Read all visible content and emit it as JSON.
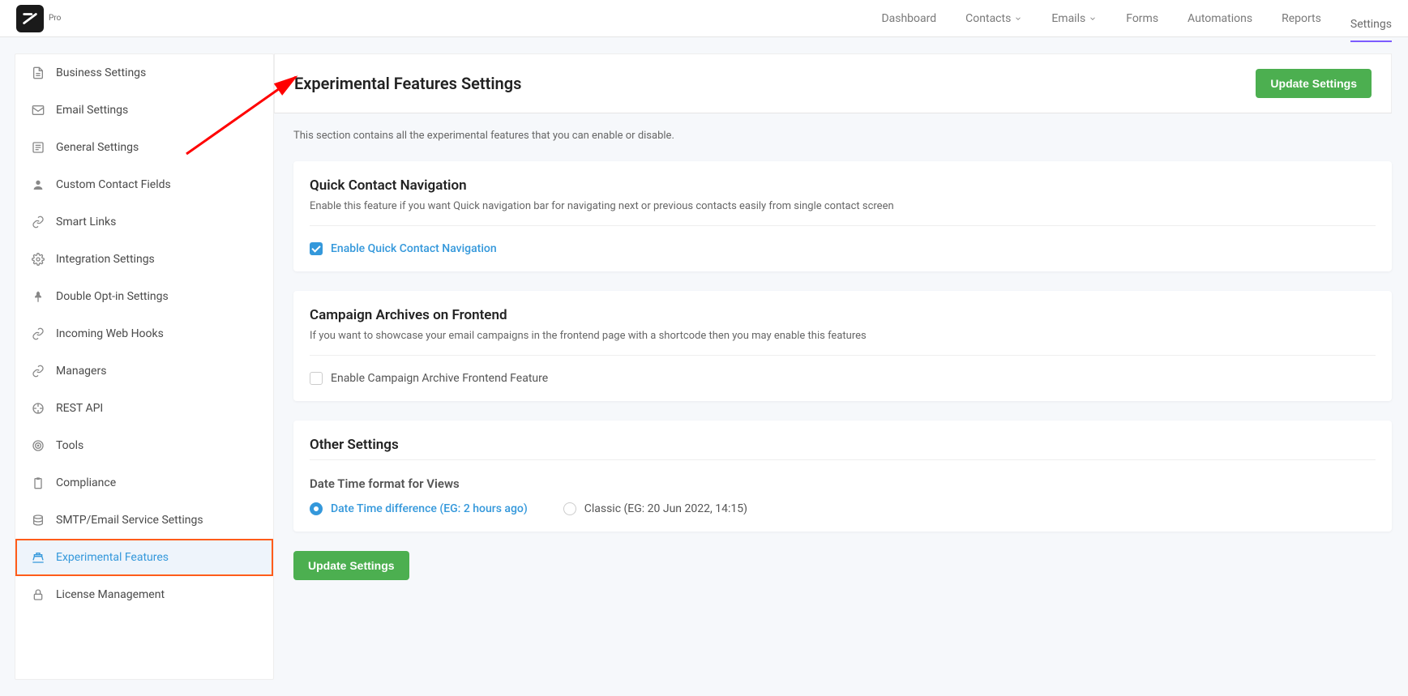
{
  "header": {
    "pro_label": "Pro",
    "nav": [
      {
        "label": "Dashboard",
        "dropdown": false,
        "active": false
      },
      {
        "label": "Contacts",
        "dropdown": true,
        "active": false
      },
      {
        "label": "Emails",
        "dropdown": true,
        "active": false
      },
      {
        "label": "Forms",
        "dropdown": false,
        "active": false
      },
      {
        "label": "Automations",
        "dropdown": false,
        "active": false
      },
      {
        "label": "Reports",
        "dropdown": false,
        "active": false
      },
      {
        "label": "Settings",
        "dropdown": false,
        "active": true
      }
    ]
  },
  "sidebar": {
    "items": [
      {
        "label": "Business Settings",
        "icon": "document-icon"
      },
      {
        "label": "Email Settings",
        "icon": "mail-icon"
      },
      {
        "label": "General Settings",
        "icon": "list-icon"
      },
      {
        "label": "Custom Contact Fields",
        "icon": "person-icon"
      },
      {
        "label": "Smart Links",
        "icon": "link-icon"
      },
      {
        "label": "Integration Settings",
        "icon": "gear-icon"
      },
      {
        "label": "Double Opt-in Settings",
        "icon": "pushpin-icon"
      },
      {
        "label": "Incoming Web Hooks",
        "icon": "link-icon"
      },
      {
        "label": "Managers",
        "icon": "link-icon"
      },
      {
        "label": "REST API",
        "icon": "api-icon"
      },
      {
        "label": "Tools",
        "icon": "target-icon"
      },
      {
        "label": "Compliance",
        "icon": "clipboard-icon"
      },
      {
        "label": "SMTP/Email Service Settings",
        "icon": "stack-icon"
      },
      {
        "label": "Experimental Features",
        "icon": "ship-icon",
        "active": true,
        "highlighted": true
      },
      {
        "label": "License Management",
        "icon": "lock-icon"
      }
    ]
  },
  "page": {
    "title": "Experimental Features Settings",
    "update_button": "Update Settings",
    "intro": "This section contains all the experimental features that you can enable or disable.",
    "cards": {
      "quick_nav": {
        "title": "Quick Contact Navigation",
        "desc": "Enable this feature if you want Quick navigation bar for navigating next or previous contacts easily from single contact screen",
        "checkbox_label": "Enable Quick Contact Navigation",
        "checked": true
      },
      "campaign": {
        "title": "Campaign Archives on Frontend",
        "desc": "If you want to showcase your email campaigns in the frontend page with a shortcode then you may enable this features",
        "checkbox_label": "Enable Campaign Archive Frontend Feature",
        "checked": false
      },
      "other": {
        "title": "Other Settings",
        "subtitle": "Date Time format for Views",
        "option1": "Date Time difference (EG: 2 hours ago)",
        "option2": "Classic (EG: 20 Jun 2022, 14:15)",
        "selected": 1
      }
    },
    "bottom_button": "Update Settings"
  }
}
